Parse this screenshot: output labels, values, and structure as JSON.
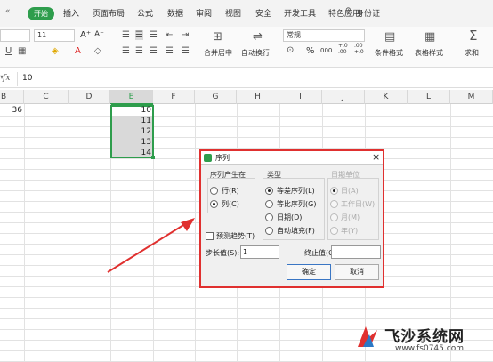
{
  "ribbon": {
    "active_tab": "开始",
    "tabs": [
      "插入",
      "页面布局",
      "公式",
      "数据",
      "审阅",
      "视图",
      "安全",
      "开发工具",
      "特色应用"
    ],
    "search_label": "身份证"
  },
  "toolbar": {
    "font_size": "11",
    "font_grow": "A⁺",
    "font_shrink": "A⁻",
    "number_format": "常规",
    "merge_center": "合并居中",
    "wrap_text": "自动换行",
    "conditional_format": "条件格式",
    "table_style": "表格样式",
    "sum": "求和",
    "percent": "%",
    "thousands": "000",
    "dec_inc": "+.0 .00",
    "dec_dec": ".00 +.0"
  },
  "formula_bar": {
    "fx": "fx",
    "value": "10"
  },
  "grid": {
    "columns": [
      "B",
      "C",
      "D",
      "E",
      "F",
      "G",
      "H",
      "I",
      "J",
      "K",
      "L",
      "M"
    ],
    "b_value": "36",
    "e_values": [
      "10",
      "11",
      "12",
      "13",
      "14"
    ]
  },
  "dialog": {
    "title": "序列",
    "close": "×",
    "series_in_label": "序列产生在",
    "series_in": [
      "行(R)",
      "列(C)"
    ],
    "type_label": "类型",
    "types": [
      "等差序列(L)",
      "等比序列(G)",
      "日期(D)",
      "自动填充(F)"
    ],
    "date_unit_label": "日期单位",
    "date_units": [
      "日(A)",
      "工作日(W)",
      "月(M)",
      "年(Y)"
    ],
    "trend": "预测趋势(T)",
    "step_label": "步长值(S):",
    "step_value": "1",
    "stop_label": "终止值(O):",
    "stop_value": "",
    "ok": "确定",
    "cancel": "取消"
  },
  "watermark": {
    "name": "飞沙系统网",
    "url": "www.fs0745.com"
  },
  "colors": {
    "accent_green": "#2e9d4c",
    "highlight_red": "#e0302f"
  }
}
